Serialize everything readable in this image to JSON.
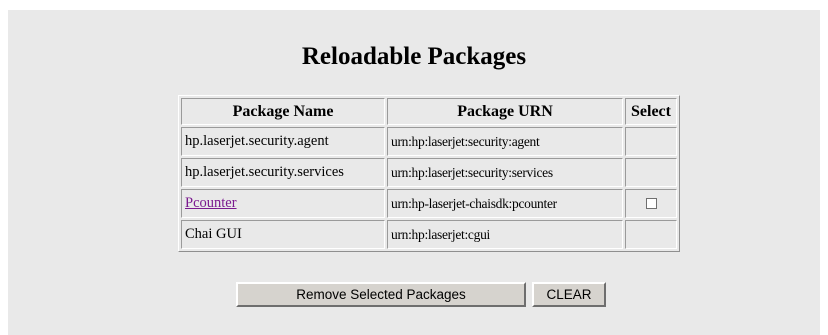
{
  "page": {
    "title": "Reloadable Packages"
  },
  "table": {
    "headers": [
      "Package Name",
      "Package URN",
      "Select"
    ],
    "rows": [
      {
        "name": "hp.laserjet.security.agent",
        "urn": "urn:hp:laserjet:security:agent",
        "link": false,
        "checkbox": false
      },
      {
        "name": "hp.laserjet.security.services",
        "urn": "urn:hp:laserjet:security:services",
        "link": false,
        "checkbox": false
      },
      {
        "name": "Pcounter",
        "urn": "urn:hp-laserjet-chaisdk:pcounter",
        "link": true,
        "checkbox": true,
        "checked": false
      },
      {
        "name": "Chai GUI",
        "urn": "urn:hp:laserjet:cgui",
        "link": false,
        "checkbox": false
      }
    ]
  },
  "buttons": {
    "remove_label": "Remove Selected Packages",
    "clear_label": "CLEAR"
  },
  "colors": {
    "panel_bg": "#e9e9e9",
    "link": "#7b1a8f",
    "button_face": "#d6d3ce"
  }
}
